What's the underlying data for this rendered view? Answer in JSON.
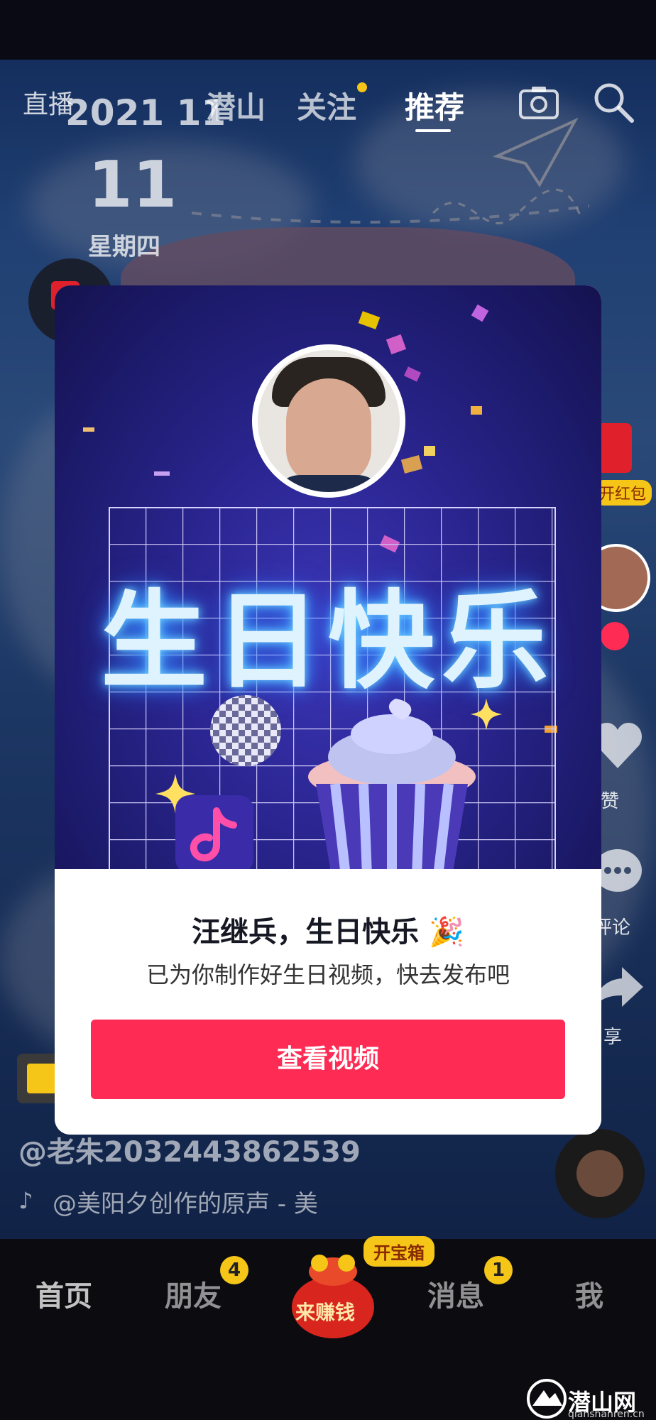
{
  "top_nav": {
    "live_label": "直播",
    "tabs": [
      {
        "label": "潜山"
      },
      {
        "label": "关注"
      },
      {
        "label": "推荐"
      }
    ],
    "active_tab": "推荐"
  },
  "date_overlay": {
    "year_month": "2021 11",
    "day": "11",
    "weekday": "星期四"
  },
  "right_rail": {
    "red_packet_label": "开红包",
    "like_label": "赞",
    "comment_label": "评论",
    "share_label": "享"
  },
  "feed": {
    "user_handle": "@老朱2032443862539",
    "music_line": "@美阳夕创作的原声 - 美"
  },
  "modal": {
    "art_title": "生日快乐",
    "title": "汪继兵，生日快乐",
    "title_emoji": "🎉",
    "subtitle": "已为你制作好生日视频，快去发布吧",
    "cta_label": "查看视频"
  },
  "bottom_nav": {
    "items": [
      {
        "label": "首页"
      },
      {
        "label": "朋友",
        "badge": "4"
      },
      {
        "label": "来赚钱",
        "tag": "开宝箱"
      },
      {
        "label": "消息",
        "badge": "1"
      },
      {
        "label": "我"
      }
    ]
  },
  "watermark": {
    "brand": "潜山网",
    "domain": "qianshanren.cn"
  },
  "colors": {
    "cta": "#fe2c55",
    "badge": "#f5c518",
    "modal_art_bg": "#2a2590"
  }
}
